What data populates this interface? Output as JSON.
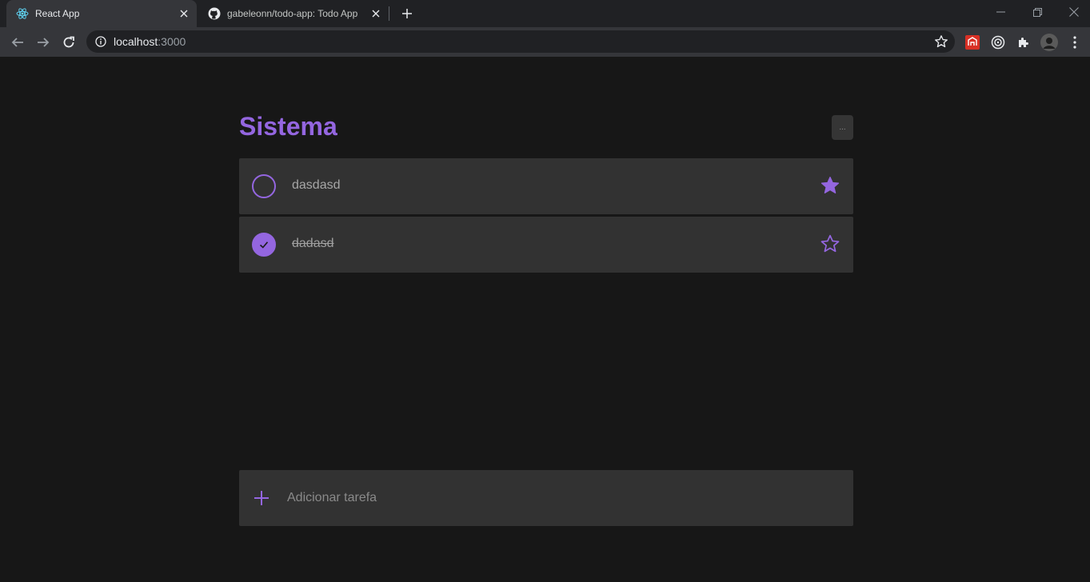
{
  "browser": {
    "tabs": [
      {
        "title": "React App",
        "icon": "react-icon"
      },
      {
        "title": "gabeleonn/todo-app: Todo App",
        "icon": "github-icon"
      }
    ],
    "url_host": "localhost",
    "url_port": ":3000"
  },
  "app": {
    "title": "Sistema",
    "menu_label": "...",
    "accent_color": "#9466e0",
    "tasks": [
      {
        "text": "dasdasd",
        "completed": false,
        "starred": true
      },
      {
        "text": "dadasd",
        "completed": true,
        "starred": false
      }
    ],
    "add_placeholder": "Adicionar tarefa"
  }
}
